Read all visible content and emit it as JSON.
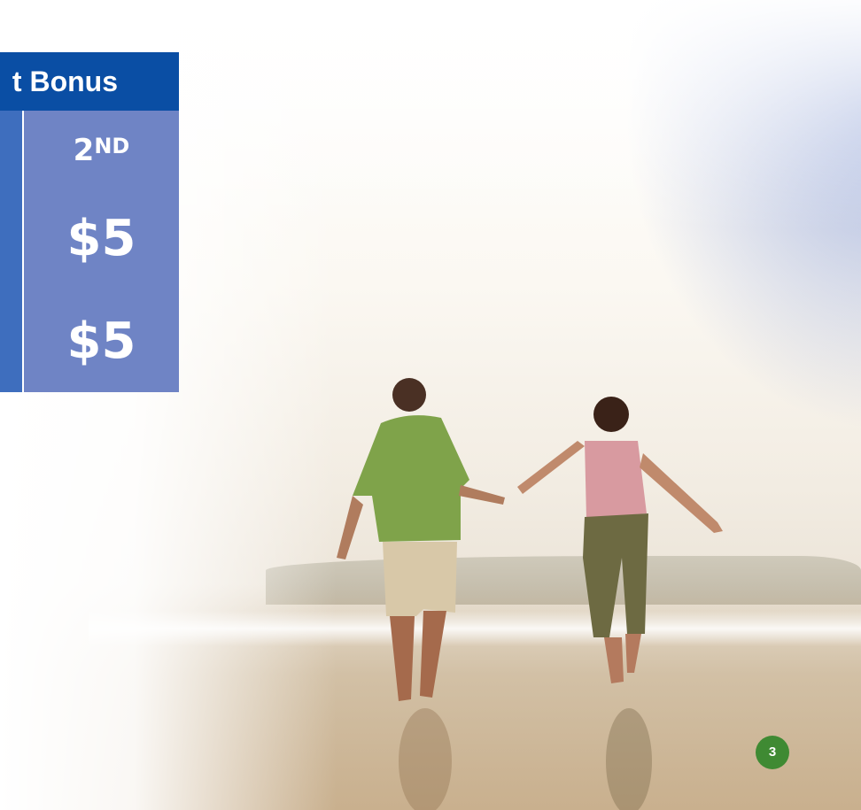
{
  "bonus_table": {
    "header": "t Bonus",
    "column": {
      "label_number": "2",
      "label_suffix": "ND",
      "values": [
        "$5",
        "$5"
      ]
    }
  },
  "page": {
    "number": "3"
  },
  "colors": {
    "header_blue": "#0a4ea4",
    "column_blue": "#3e6ebe",
    "column_periwinkle": "#6f84c5",
    "page_badge_green": "#3f8a33"
  }
}
